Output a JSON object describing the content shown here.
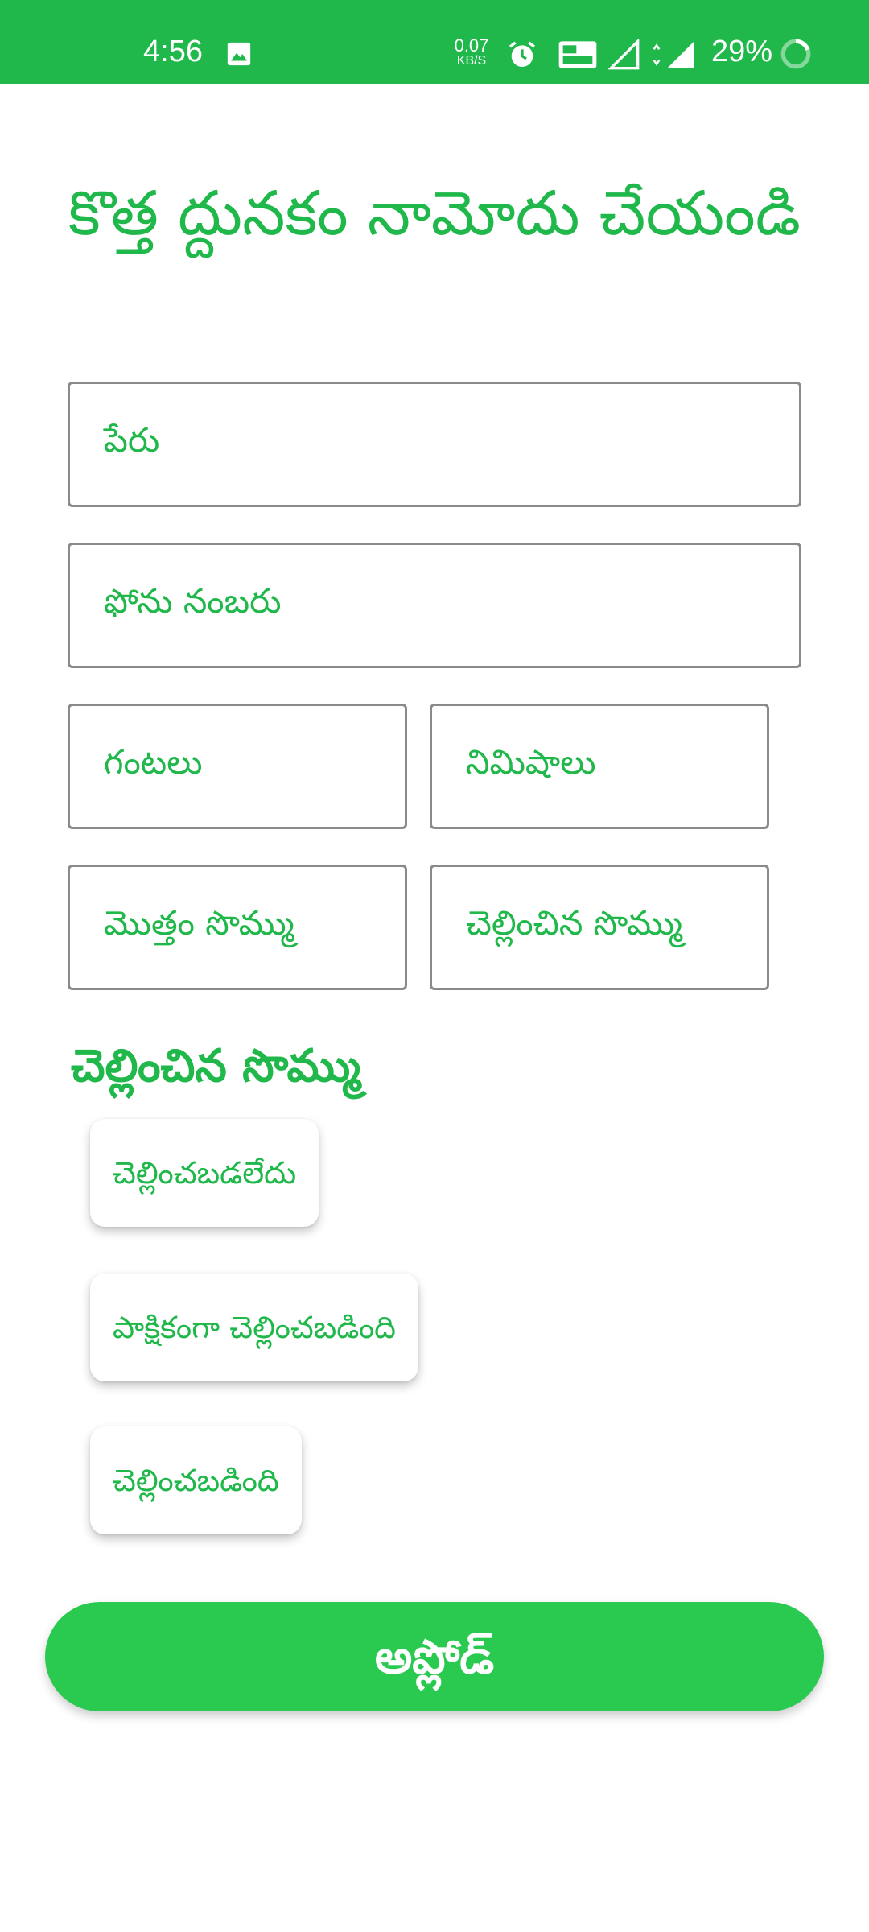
{
  "status_bar": {
    "time": "4:56",
    "network_speed_value": "0.07",
    "network_speed_unit": "KB/S",
    "battery_percent": "29%",
    "background_color": "#21b84b",
    "icons": [
      "image-icon",
      "alarm-icon",
      "volte-icon",
      "signal-icon",
      "signal-4g-icon",
      "battery-ring-icon"
    ]
  },
  "form": {
    "title": "కొత్త ద్దునకం నామోదు చేయండి",
    "fields": {
      "name_placeholder": "పేరు",
      "phone_placeholder": "ఫోను నంబరు",
      "hours_placeholder": "గంటలు",
      "minutes_placeholder": "నిమిషాలు",
      "total_amount_placeholder": "మొత్తం సొమ్ము",
      "paid_amount_placeholder": "చెల్లించిన సొమ్ము"
    },
    "payment_section_label": "చెల్లించిన సొమ్ము",
    "payment_options": {
      "not_paid": "చెల్లించబడలేదు",
      "partially_paid": "పాక్షికంగా చెల్లించబడింది",
      "paid": "చెల్లించబడింది"
    },
    "upload_label": "అప్లోడ్",
    "accent_color": "#21b84b"
  }
}
